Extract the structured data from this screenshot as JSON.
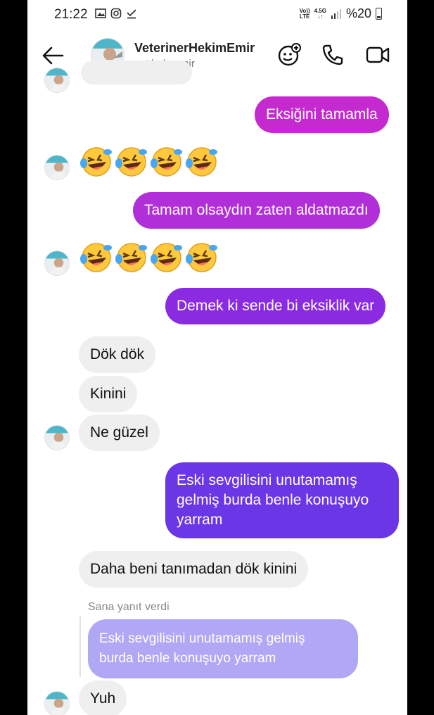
{
  "status": {
    "time": "21:22",
    "network_top": "Vo))",
    "network_bottom": "LTE",
    "gen": "4.5G",
    "battery_text": "%20"
  },
  "header": {
    "name": "VeterinerHekimEmir",
    "handle": "vet.hek_emir"
  },
  "icons": [
    "back-arrow-icon",
    "sticker-add-icon",
    "phone-icon",
    "video-call-icon"
  ],
  "colors": {
    "out_pink": "#c52ad0",
    "out_purple": "#8a2be2",
    "out_violet": "#6a36e6",
    "in_gray": "#efefef",
    "reply_quote": "#b1a8f5"
  },
  "messages": [
    {
      "id": "m1",
      "dir": "out",
      "text": "Eksiğini tamamla"
    },
    {
      "id": "m2",
      "dir": "in",
      "emoji": "🤣🤣🤣🤣"
    },
    {
      "id": "m3",
      "dir": "out",
      "text": "Tamam olsaydın zaten aldatmazdı"
    },
    {
      "id": "m4",
      "dir": "in",
      "emoji": "🤣🤣🤣🤣"
    },
    {
      "id": "m5",
      "dir": "out",
      "text": "Demek ki sende bi eksiklik var"
    },
    {
      "id": "m6",
      "dir": "in",
      "text": "Dök dök"
    },
    {
      "id": "m7",
      "dir": "in",
      "text": "Kinini"
    },
    {
      "id": "m8",
      "dir": "in",
      "text": "Ne güzel"
    },
    {
      "id": "m9",
      "dir": "out",
      "lines": [
        "Eski sevgilisini unutamamış",
        "gelmiş burda benle konuşuyo",
        "yarram"
      ]
    },
    {
      "id": "m10",
      "dir": "in",
      "text": "Daha beni tanımadan dök kinini"
    },
    {
      "id": "m11",
      "dir": "in",
      "reply_label": "Sana yanıt verdi",
      "quote_lines": [
        "Eski sevgilisini unutamamış gelmiş",
        "burda benle konuşuyo yarram"
      ],
      "text": "Yuh"
    }
  ]
}
